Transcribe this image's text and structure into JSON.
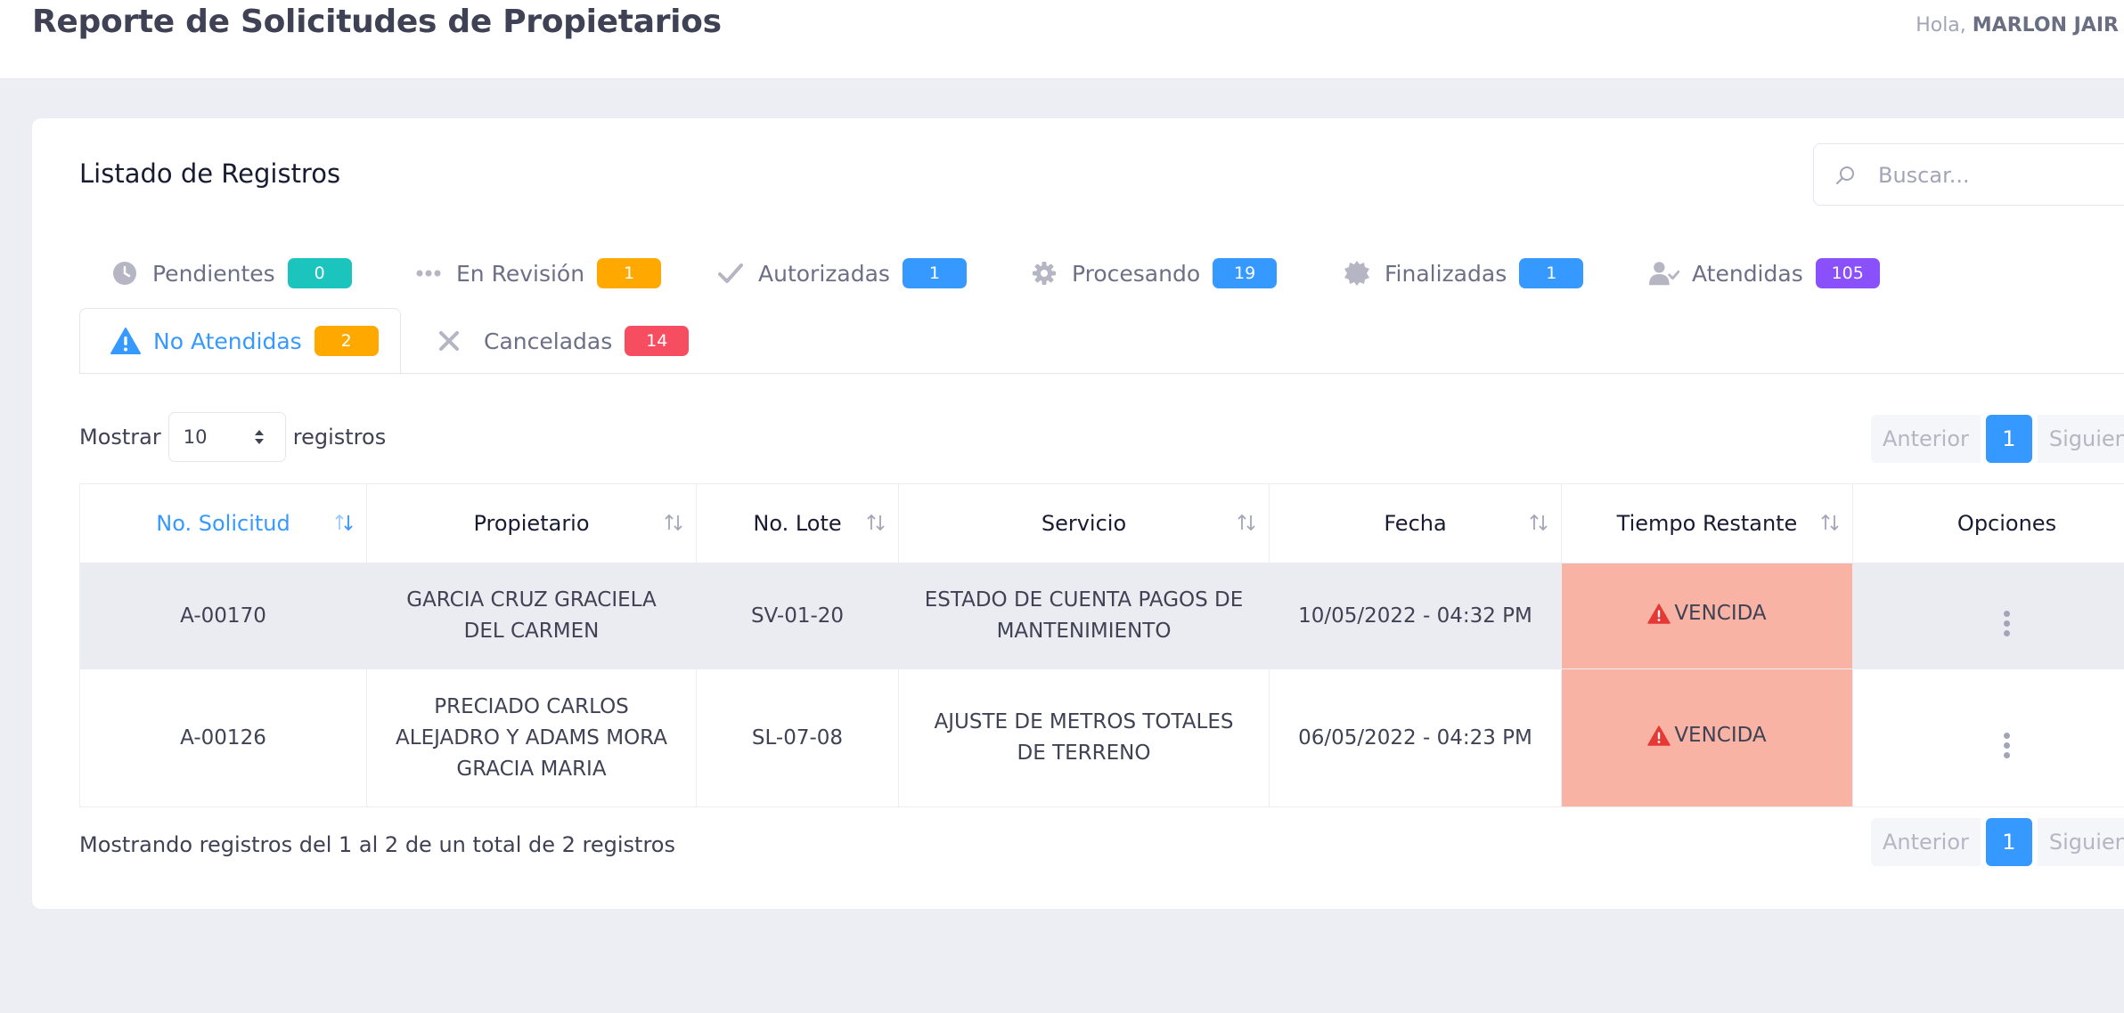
{
  "header": {
    "title": "Reporte de Solicitudes de Propietarios",
    "greeting_prefix": "Hola,",
    "user_name": "MARLON JAIR"
  },
  "card": {
    "title": "Listado de Registros",
    "search_placeholder": "Buscar..."
  },
  "tabs": [
    {
      "label": "Pendientes",
      "count": "0",
      "icon": "clock-icon",
      "color": "#1bc5bd"
    },
    {
      "label": "En Revisión",
      "count": "1",
      "icon": "dots-icon",
      "color": "#ffa800"
    },
    {
      "label": "Autorizadas",
      "count": "1",
      "icon": "check-icon",
      "color": "#3699ff"
    },
    {
      "label": "Procesando",
      "count": "19",
      "icon": "gear-icon",
      "color": "#3699ff"
    },
    {
      "label": "Finalizadas",
      "count": "1",
      "icon": "badge-seal-icon",
      "color": "#3699ff"
    },
    {
      "label": "Atendidas",
      "count": "105",
      "icon": "user-check-icon",
      "color": "#8950fc"
    },
    {
      "label": "No Atendidas",
      "count": "2",
      "icon": "warning-icon",
      "color": "#ffa800",
      "active": true
    },
    {
      "label": "Canceladas",
      "count": "14",
      "icon": "close-icon",
      "color": "#f64e60"
    }
  ],
  "length_control": {
    "prefix": "Mostrar",
    "value": "10",
    "suffix": "registros"
  },
  "pagination": {
    "previous": "Anterior",
    "current_page": "1",
    "next": "Siguien"
  },
  "table": {
    "columns": [
      "No. Solicitud",
      "Propietario",
      "No. Lote",
      "Servicio",
      "Fecha",
      "Tiempo Restante",
      "Opciones"
    ],
    "rows": [
      {
        "solicitud": "A-00170",
        "propietario": "GARCIA CRUZ GRACIELA DEL CARMEN",
        "lote": "SV-01-20",
        "servicio": "ESTADO DE CUENTA PAGOS DE MANTENIMIENTO",
        "fecha": "10/05/2022 - 04:32 PM",
        "tiempo": "VENCIDA"
      },
      {
        "solicitud": "A-00126",
        "propietario": "PRECIADO CARLOS ALEJADRO Y ADAMS MORA GRACIA MARIA",
        "lote": "SL-07-08",
        "servicio": "AJUSTE DE METROS TOTALES DE TERRENO",
        "fecha": "06/05/2022 - 04:23 PM",
        "tiempo": "VENCIDA"
      }
    ]
  },
  "footer_info": "Mostrando registros del 1 al 2 de un total de 2 registros",
  "colors": {
    "accent": "#3699ff",
    "overdue_cell": "#f9b3a5",
    "selected_row": "#ebecf1"
  }
}
